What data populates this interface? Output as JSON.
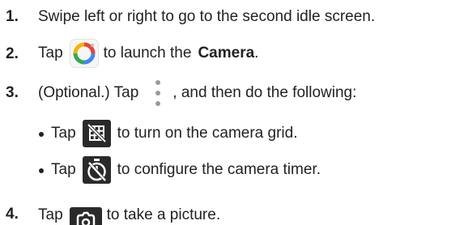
{
  "steps": [
    {
      "number": "1.",
      "text": "Swipe left or right to go to the second idle screen."
    },
    {
      "number": "2.",
      "before": "Tap",
      "icon": "camera-app-icon",
      "after": "to launch the",
      "bold": "Camera",
      "end": "."
    },
    {
      "number": "3.",
      "before": "(Optional.) Tap",
      "icon": "kebab-menu-icon",
      "after": ", and then do the following:"
    },
    {
      "number": "4.",
      "before": "Tap",
      "icon": "shutter-icon",
      "after": "to take a picture."
    }
  ],
  "substeps": [
    {
      "before": "Tap",
      "icon": "grid-icon",
      "after": "to turn on the camera grid."
    },
    {
      "before": "Tap",
      "icon": "timer-icon",
      "after": "to configure the camera timer."
    }
  ],
  "colors": {
    "text": "#222222",
    "icon_dark": "#2a2a2a",
    "kebab_dots": "#9a9a9a",
    "camera_ring": [
      "#f4b400",
      "#ea4335",
      "#4285f4",
      "#34a853"
    ]
  }
}
